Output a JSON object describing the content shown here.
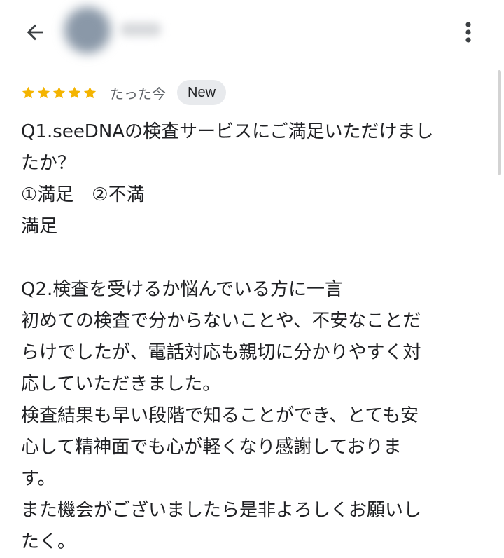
{
  "header": {
    "back_icon": "arrow-back-icon",
    "more_icon": "more-vert-icon"
  },
  "review": {
    "rating": 5,
    "rating_max": 5,
    "star_color": "#f4b400",
    "timestamp": "たった今",
    "badge": "New",
    "lines": [
      "Q1.seeDNAの検査サービスにご満足いただけまし",
      "たか？",
      "①満足　②不満",
      "満足",
      "",
      "Q2.検査を受けるか悩んでいる方に一言",
      "初めての検査で分からないことや、不安なことだ",
      "らけでしたが、電話対応も親切に分かりやすく対",
      "応していただきました。",
      "検査結果も早い段階で知ることができ、とても安",
      "心して精神面でも心が軽くなり感謝しておりま",
      "す。",
      "また機会がございましたら是非よろしくお願いし",
      "たく。"
    ]
  }
}
